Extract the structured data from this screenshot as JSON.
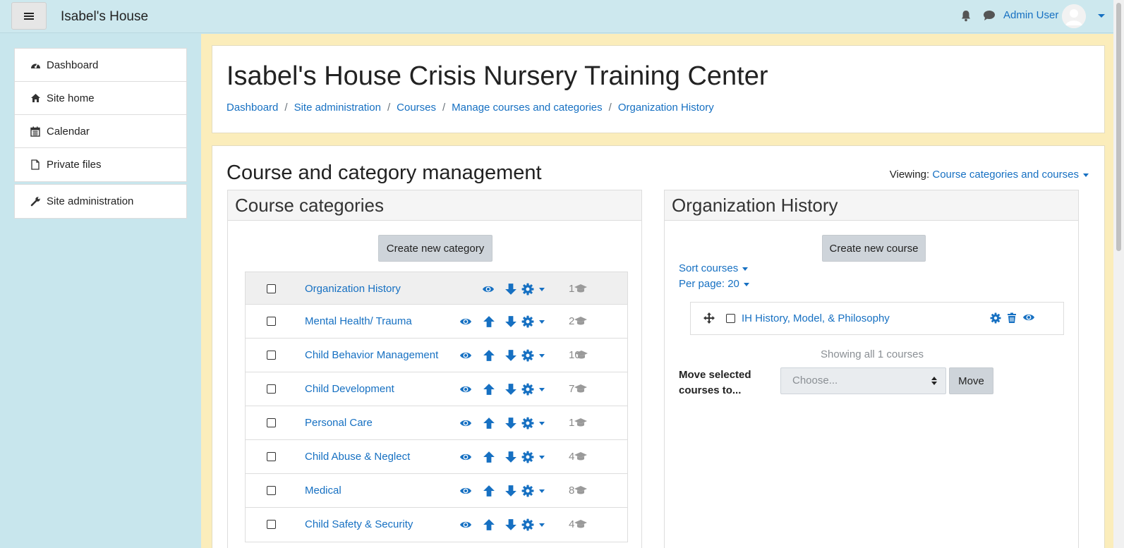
{
  "navbar": {
    "site_name": "Isabel's House",
    "user_name": "Admin User"
  },
  "sidebar": {
    "items": [
      {
        "label": "Dashboard",
        "icon": "dashboard-icon"
      },
      {
        "label": "Site home",
        "icon": "home-icon"
      },
      {
        "label": "Calendar",
        "icon": "calendar-icon"
      },
      {
        "label": "Private files",
        "icon": "file-icon"
      }
    ],
    "admin_item": {
      "label": "Site administration",
      "icon": "wrench-icon"
    }
  },
  "header": {
    "title": "Isabel's House Crisis Nursery Training Center",
    "breadcrumb": [
      "Dashboard",
      "Site administration",
      "Courses",
      "Manage courses and categories",
      "Organization History"
    ]
  },
  "management": {
    "title": "Course and category management",
    "viewing_label": "Viewing:",
    "viewing_value": "Course categories and courses"
  },
  "categories_panel": {
    "title": "Course categories",
    "create_button": "Create new category",
    "categories": [
      {
        "name": "Organization History",
        "count": "1"
      },
      {
        "name": "Mental Health/ Trauma",
        "count": "2"
      },
      {
        "name": "Child Behavior Management",
        "count": "10"
      },
      {
        "name": "Child Development",
        "count": "7"
      },
      {
        "name": "Personal Care",
        "count": "1"
      },
      {
        "name": "Child Abuse & Neglect",
        "count": "4"
      },
      {
        "name": "Medical",
        "count": "8"
      },
      {
        "name": "Child Safety & Security",
        "count": "4"
      }
    ]
  },
  "courses_panel": {
    "title": "Organization History",
    "create_button": "Create new course",
    "sort_label": "Sort courses",
    "per_page_label": "Per page: 20",
    "courses": [
      {
        "name": "IH History, Model, & Philosophy"
      }
    ],
    "showing_text": "Showing all 1 courses",
    "move_label": "Move selected courses to...",
    "select_placeholder": "Choose...",
    "move_button": "Move"
  },
  "colors": {
    "link": "#1670c2",
    "navbar_bg": "#cde8ee",
    "main_bg": "#fbedbb"
  }
}
